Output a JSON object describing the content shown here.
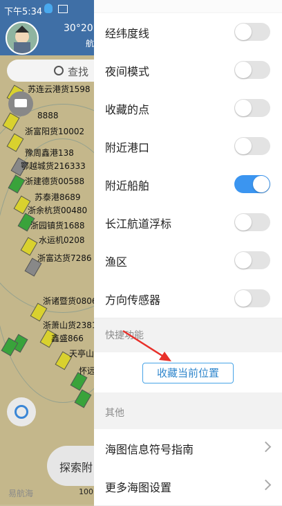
{
  "status": {
    "time": "下午5:34"
  },
  "map": {
    "coord": "30°20'",
    "coord2": "航",
    "search_label": "查找",
    "explore_label": "探索附",
    "logo": "易航海",
    "scale": "100",
    "ships": [
      "苏连云港货1598",
      "8888",
      "浙富阳货10002",
      "豫周鑫港138",
      "鄂越城货216333",
      "浙建德货00588",
      "苏泰港8689",
      "浙余杭货00480",
      "浙园镇货1688",
      "水运机0208",
      "浙富达货7286",
      "浙诸暨货0806",
      "浙萧山货2381",
      "鑫盛866",
      "天亭山",
      "怀远"
    ]
  },
  "drawer": {
    "toggles": [
      {
        "label": "经纬度线",
        "on": false
      },
      {
        "label": "夜间模式",
        "on": false
      },
      {
        "label": "收藏的点",
        "on": false
      },
      {
        "label": "附近港口",
        "on": false
      },
      {
        "label": "附近船舶",
        "on": true
      },
      {
        "label": "长江航道浮标",
        "on": false
      },
      {
        "label": "渔区",
        "on": false
      },
      {
        "label": "方向传感器",
        "on": false
      }
    ],
    "quick_section": "快捷功能",
    "favorite_button": "收藏当前位置",
    "other_section": "其他",
    "links": [
      "海图信息符号指南",
      "更多海图设置"
    ]
  },
  "colors": {
    "accent": "#3b95f0",
    "annotation": "#e8302a"
  }
}
